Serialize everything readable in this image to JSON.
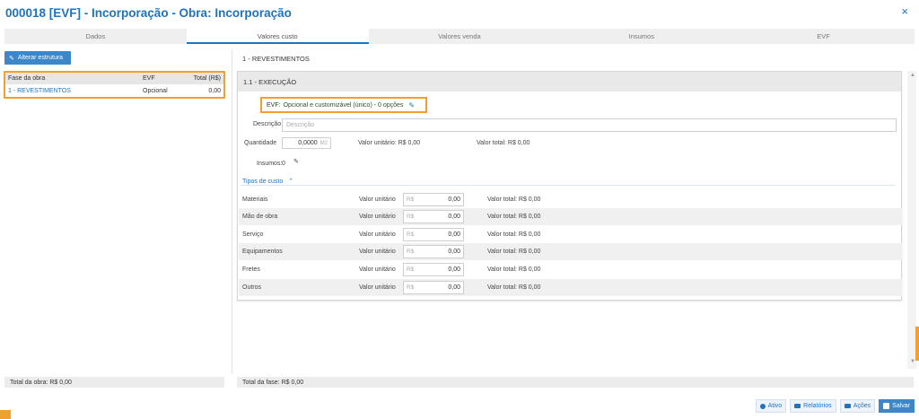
{
  "window": {
    "title": "000018 [EVF] - Incorporação - Obra: Incorporação",
    "close": "×"
  },
  "tabs": [
    {
      "label": "Dados"
    },
    {
      "label": "Valores custo"
    },
    {
      "label": "Valores venda"
    },
    {
      "label": "Insumos"
    },
    {
      "label": "EVF"
    }
  ],
  "left": {
    "alter_button": "Alterar estrutura",
    "grid": {
      "headers": [
        "Fase da obra",
        "EVF",
        "Total (R$)"
      ],
      "rows": [
        {
          "fase": "1 - REVESTIMENTOS",
          "evf": "Opcional",
          "total": "0,00"
        }
      ]
    },
    "total_obra": "Total da obra: R$ 0,00"
  },
  "right": {
    "section_title": "1 - REVESTIMENTOS",
    "card_title": "1.1 - EXECUÇÃO",
    "evf_label": "EVF:",
    "evf_value": "Opcional e customizável (único) - 0 opções",
    "descricao_label": "Descrição",
    "descricao_placeholder": "Descrição",
    "quantidade_label": "Quantidade",
    "quantidade_value": "0,0000",
    "quantidade_unit": "M2",
    "valor_unitario_text": "Valor unitário: R$ 0,00",
    "valor_total_text": "Valor total: R$ 0,00",
    "insumos_label": "Insumos:",
    "insumos_value": "0",
    "tipos_label": "Tipos de custo",
    "costs": [
      {
        "name": "Materiais",
        "vu_label": "Valor unitário",
        "currency": "R$",
        "value": "0,00",
        "total": "Valor total: R$ 0,00"
      },
      {
        "name": "Mão de obra",
        "vu_label": "Valor unitário",
        "currency": "R$",
        "value": "0,00",
        "total": "Valor total: R$ 0,00"
      },
      {
        "name": "Serviço",
        "vu_label": "Valor unitário",
        "currency": "R$",
        "value": "0,00",
        "total": "Valor total: R$ 0,00"
      },
      {
        "name": "Equipamentos",
        "vu_label": "Valor unitário",
        "currency": "R$",
        "value": "0,00",
        "total": "Valor total: R$ 0,00"
      },
      {
        "name": "Fretes",
        "vu_label": "Valor unitário",
        "currency": "R$",
        "value": "0,00",
        "total": "Valor total: R$ 0,00"
      },
      {
        "name": "Outros",
        "vu_label": "Valor unitário",
        "currency": "R$",
        "value": "0,00",
        "total": "Valor total: R$ 0,00"
      }
    ],
    "total_fase": "Total da fase: R$ 0,00"
  },
  "footer": {
    "ativo": "Ativo",
    "relatorios": "Relatórios",
    "acoes": "Ações",
    "salvar": "Salvar"
  },
  "colors": {
    "accent": "#1e73be",
    "highlight": "#f0a030"
  }
}
